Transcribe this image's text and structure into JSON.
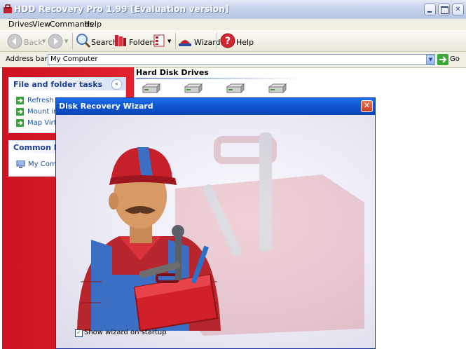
{
  "window": {
    "title": "HDD Recovery Pro 1.99 [Evaluation version]"
  },
  "menu": {
    "items": [
      "Drives",
      "View",
      "Commands",
      "Help"
    ]
  },
  "toolbar": {
    "back_label": "Back",
    "search_label": "Search",
    "folders_label": "Folders",
    "wizard_label": "Wizard",
    "help_label": "Help"
  },
  "address": {
    "label": "Address bar:",
    "value": "My Computer",
    "go_label": "Go"
  },
  "sidebar": {
    "tasks": {
      "title": "File and folder tasks",
      "items": [
        "Refresh List",
        "Mount image",
        "Map Virtual"
      ]
    },
    "places": {
      "title": "Common Places",
      "items": [
        "My Computer"
      ]
    }
  },
  "main": {
    "section_title": "Hard Disk Drives",
    "drive_count": 4
  },
  "wizard": {
    "title": "Disk Recovery Wizard",
    "close_label": "✕",
    "startup_checkbox_label": "Show wizard on startup",
    "startup_checked": true
  },
  "colors": {
    "sidebar_red": "#d81824",
    "wizard_title_blue": "#0d51cd",
    "link_blue": "#1d4ea8"
  }
}
